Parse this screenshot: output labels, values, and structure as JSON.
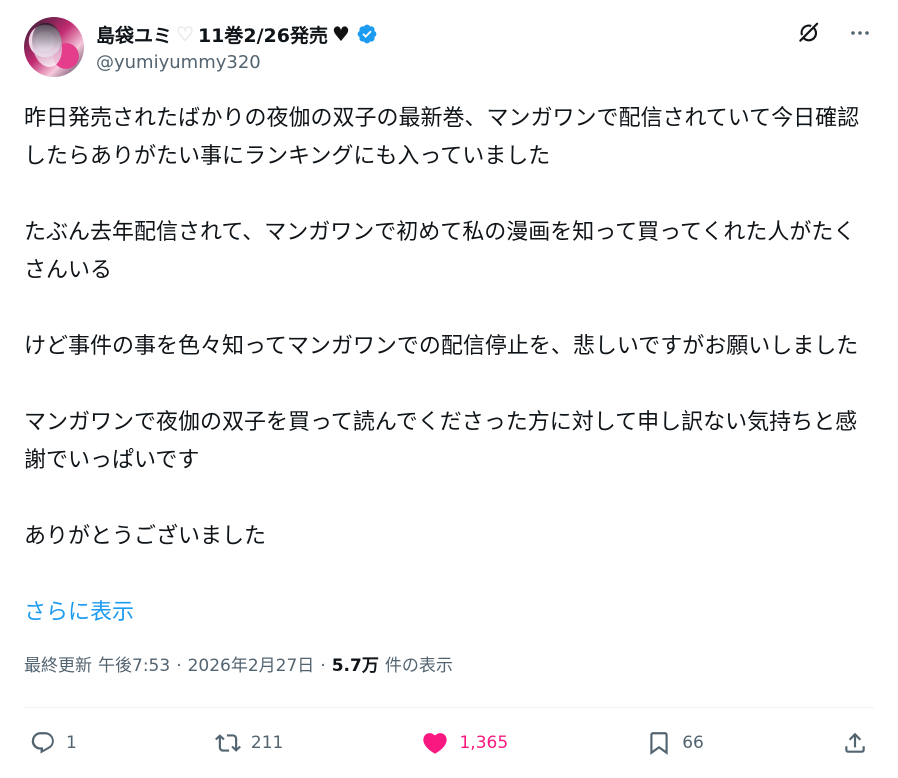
{
  "author": {
    "name": "島袋ユミ",
    "name_suffix_1": "11巻2/26発売",
    "heart_white_icon": "white-heart",
    "heart_black_icon": "black-heart",
    "handle": "@yumiyummy320",
    "verified": true
  },
  "post": {
    "paragraphs": [
      "昨日発売されたばかりの夜伽の双子の最新巻、マンガワンで配信されていて今日確認したらありがたい事にランキングにも入っていました",
      "たぶん去年配信されて、マンガワンで初めて私の漫画を知って買ってくれた人がたくさんいる",
      "けど事件の事を色々知ってマンガワンでの配信停止を、悲しいですがお願いしました",
      "マンガワンで夜伽の双子を買って読んでくださった方に対して申し訳ない気持ちと感謝でいっぱいです",
      "ありがとうございました"
    ],
    "show_more": "さらに表示"
  },
  "meta": {
    "updated_label": "最終更新",
    "time": "午後7:53",
    "dot1": "·",
    "date": "2026年2月27日",
    "dot2": "·",
    "views": "5.7万",
    "views_label": "件の表示"
  },
  "actions": {
    "replies": "1",
    "reposts": "211",
    "likes": "1,365",
    "bookmarks": "66"
  },
  "colors": {
    "accent": "#1d9bf0",
    "like": "#f91880",
    "muted": "#536471"
  }
}
